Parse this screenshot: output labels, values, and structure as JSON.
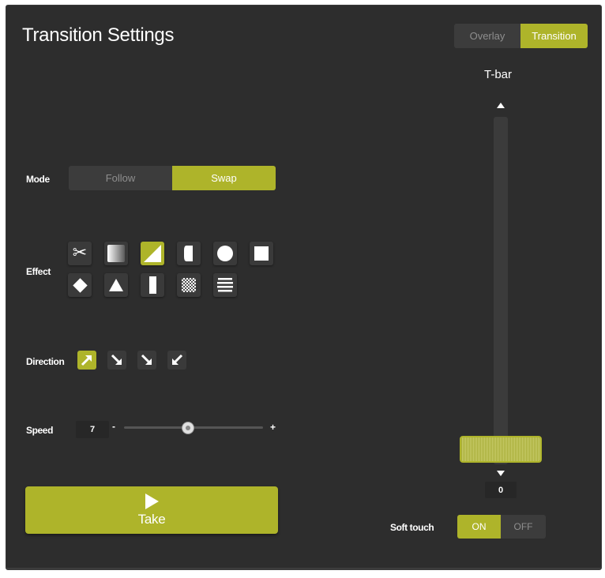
{
  "title": "Transition Settings",
  "view_toggle": {
    "overlay": "Overlay",
    "transition": "Transition",
    "selected": "Transition"
  },
  "mode": {
    "label": "Mode",
    "follow": "Follow",
    "swap": "Swap",
    "selected": "Swap"
  },
  "effect": {
    "label": "Effect",
    "icons": [
      "scissors-icon",
      "gradient-icon",
      "diagonal-wipe-icon",
      "half-rounded-icon",
      "circle-icon",
      "square-icon",
      "diamond-icon",
      "triangle-icon",
      "vertical-bar-icon",
      "checker-icon",
      "horizontal-lines-icon"
    ],
    "selected": "diagonal-wipe-icon"
  },
  "direction": {
    "label": "Direction",
    "icons": [
      "arrow-up-right-icon",
      "arrow-down-right-icon",
      "arrow-down-right-icon",
      "arrow-down-left-icon"
    ],
    "selected_index": 0
  },
  "speed": {
    "label": "Speed",
    "value": "7",
    "minus": "-",
    "plus": "+",
    "slider_fraction": 0.46
  },
  "take": {
    "label": "Take"
  },
  "tbar": {
    "label": "T-bar",
    "value": "0",
    "position_fraction": 0.0
  },
  "soft_touch": {
    "label": "Soft touch",
    "on": "ON",
    "off": "OFF",
    "selected": "ON"
  },
  "colors": {
    "accent": "#aeb42a",
    "panel": "#2d2d2d",
    "button": "#3a3a3a"
  }
}
